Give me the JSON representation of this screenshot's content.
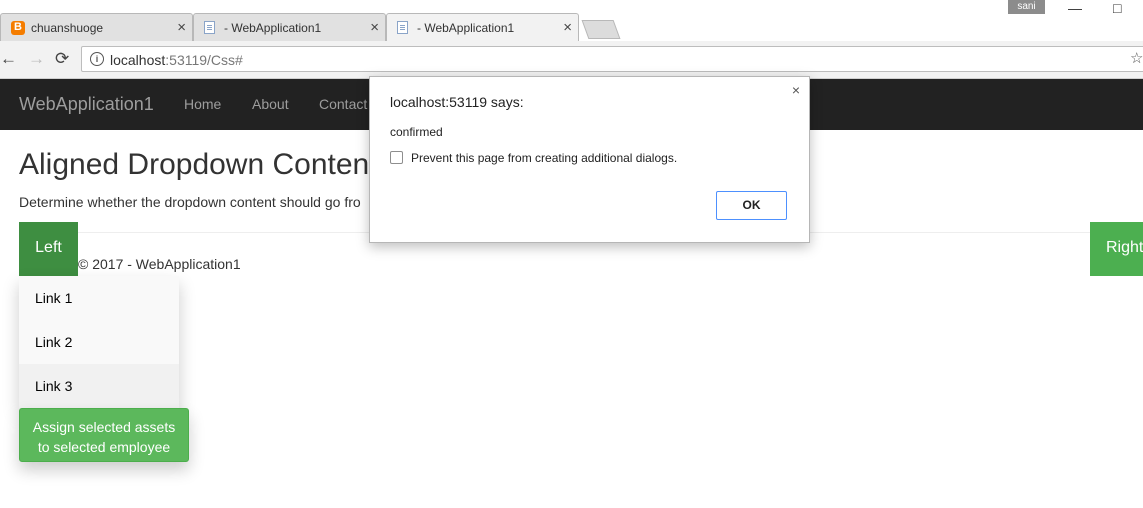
{
  "browser": {
    "tabs": [
      {
        "label": "chuanshuoge",
        "favicon": "blogger-icon"
      },
      {
        "label": "- WebApplication1",
        "favicon": "page-icon"
      },
      {
        "label": "- WebApplication1",
        "favicon": "page-icon"
      }
    ],
    "close_glyph": "×",
    "user": "sani",
    "minimize_glyph": "—",
    "maximize_glyph": "□",
    "back_glyph": "←",
    "forward_glyph": "→",
    "reload_glyph": "⟳",
    "info_glyph": "i",
    "star_glyph": "☆",
    "url_host": "localhost",
    "url_path": ":53119/Css#"
  },
  "navbar": {
    "brand": "WebApplication1",
    "links": [
      "Home",
      "About",
      "Contact"
    ]
  },
  "page": {
    "heading": "Aligned Dropdown Conten",
    "lead": "Determine whether the dropdown content should go fro",
    "left_button": "Left",
    "right_button": "Right",
    "dropdown_items": [
      "Link 1",
      "Link 2",
      "Link 3"
    ],
    "assign_button_line1": "Assign selected assets",
    "assign_button_line2": "to selected employee",
    "footer": "© 2017 - WebApplication1"
  },
  "dialog": {
    "title": "localhost:53119 says:",
    "message": "confirmed",
    "checkbox_label": "Prevent this page from creating additional dialogs.",
    "ok_label": "OK",
    "close_glyph": "×"
  },
  "colors": {
    "navbar_bg": "#222222",
    "left_button_bg": "#3e8e41",
    "right_button_bg": "#4caf50",
    "assign_button_bg": "#5cb85c",
    "ok_border": "#4d90fe"
  }
}
